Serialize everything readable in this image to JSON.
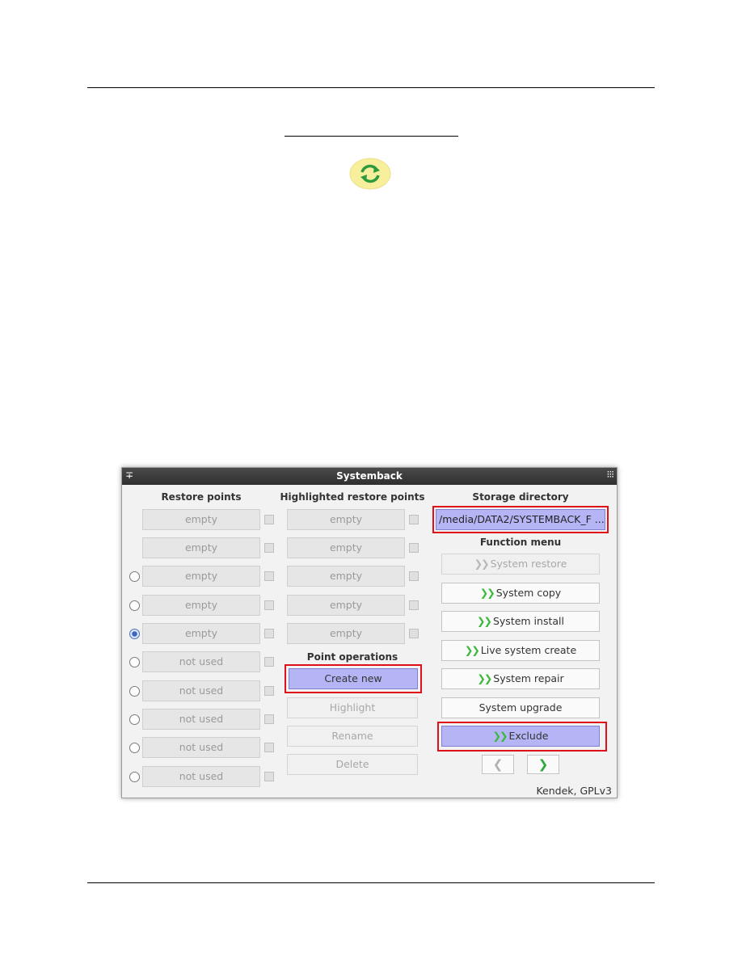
{
  "window": {
    "title": "Systemback"
  },
  "restore_points": {
    "heading": "Restore points",
    "items": [
      {
        "label": "empty",
        "radio": false,
        "selected": false
      },
      {
        "label": "empty",
        "radio": false,
        "selected": false
      },
      {
        "label": "empty",
        "radio": true,
        "selected": false
      },
      {
        "label": "empty",
        "radio": true,
        "selected": false
      },
      {
        "label": "empty",
        "radio": true,
        "selected": true
      },
      {
        "label": "not used",
        "radio": true,
        "selected": false
      },
      {
        "label": "not used",
        "radio": true,
        "selected": false
      },
      {
        "label": "not used",
        "radio": true,
        "selected": false
      },
      {
        "label": "not used",
        "radio": true,
        "selected": false
      },
      {
        "label": "not used",
        "radio": true,
        "selected": false
      }
    ]
  },
  "highlighted": {
    "heading": "Highlighted restore points",
    "items": [
      "empty",
      "empty",
      "empty",
      "empty",
      "empty"
    ]
  },
  "point_operations": {
    "heading": "Point operations",
    "create_new": "Create new",
    "highlight": "Highlight",
    "rename": "Rename",
    "delete": "Delete"
  },
  "storage": {
    "heading": "Storage directory",
    "value": "/media/DATA2/SYSTEMBACK_F ..."
  },
  "function_menu": {
    "heading": "Function menu",
    "system_restore": "System restore",
    "system_copy": "System copy",
    "system_install": "System install",
    "live_system_create": "Live system create",
    "system_repair": "System repair",
    "system_upgrade": "System upgrade",
    "exclude": "Exclude"
  },
  "footer": "Kendek, GPLv3",
  "colors": {
    "highlight": "#b5b5f5",
    "callout": "#e0101a",
    "arrow": "#3cb83c"
  }
}
